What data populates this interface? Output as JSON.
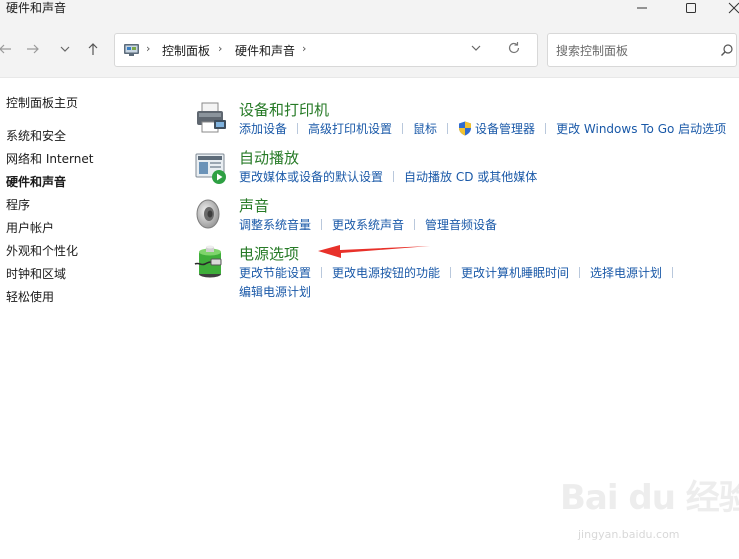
{
  "window": {
    "title": "硬件和声音"
  },
  "nav": {
    "breadcrumb": [
      "控制面板",
      "硬件和声音"
    ],
    "search_placeholder": "搜索控制面板"
  },
  "sidebar": {
    "items": [
      {
        "label": "控制面板主页",
        "current": false
      },
      {
        "label": "系统和安全",
        "current": false
      },
      {
        "label": "网络和 Internet",
        "current": false
      },
      {
        "label": "硬件和声音",
        "current": true
      },
      {
        "label": "程序",
        "current": false
      },
      {
        "label": "用户帐户",
        "current": false
      },
      {
        "label": "外观和个性化",
        "current": false
      },
      {
        "label": "时钟和区域",
        "current": false
      },
      {
        "label": "轻松使用",
        "current": false
      }
    ]
  },
  "categories": [
    {
      "title": "设备和打印机",
      "icon": "printer-icon",
      "links": [
        "添加设备",
        "高级打印机设置",
        "鼠标",
        "设备管理器",
        "更改 Windows To Go 启动选项"
      ]
    },
    {
      "title": "自动播放",
      "icon": "autoplay-icon",
      "links": [
        "更改媒体或设备的默认设置",
        "自动播放 CD 或其他媒体"
      ]
    },
    {
      "title": "声音",
      "icon": "speaker-icon",
      "links": [
        "调整系统音量",
        "更改系统声音",
        "管理音频设备"
      ]
    },
    {
      "title": "电源选项",
      "icon": "battery-icon",
      "links": [
        "更改节能设置",
        "更改电源按钮的功能",
        "更改计算机睡眠时间",
        "选择电源计划",
        "编辑电源计划"
      ]
    }
  ],
  "watermark": {
    "logo": "Bai du 经验",
    "url": "jingyan.baidu.com"
  },
  "colors": {
    "category_title": "#267a26",
    "link": "#1a59a8",
    "annotation_arrow": "#e8312a"
  }
}
